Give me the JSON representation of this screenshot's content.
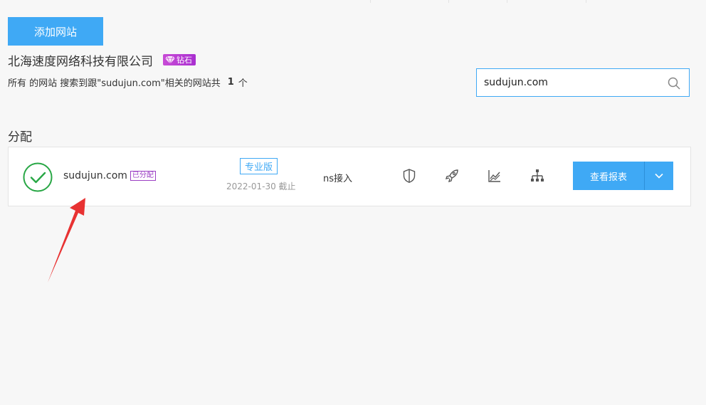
{
  "toolbar": {
    "add_site_label": "添加网站"
  },
  "account": {
    "company_name": "北海速度网络科技有限公司",
    "level_badge": "钻石"
  },
  "search": {
    "summary_prefix": "所有 的网站 搜索到跟\"sudujun.com\"相关的网站共",
    "result_count": "1",
    "result_unit": "个",
    "query": "sudujun.com"
  },
  "section": {
    "title": "分配"
  },
  "site": {
    "domain": "sudujun.com",
    "assigned_tag": "已分配",
    "plan": "专业版",
    "expire": "2022-01-30 截止",
    "access_type": "ns接入",
    "status_icon": "check-circle-icon",
    "tool_icons": [
      "shield-icon",
      "rocket-icon",
      "chart-icon",
      "sitemap-icon"
    ],
    "report_label": "查看报表"
  },
  "colors": {
    "accent": "#3fa9f5",
    "success": "#28a745",
    "diamond": "#b53ad2",
    "annotation": "#e83232"
  }
}
